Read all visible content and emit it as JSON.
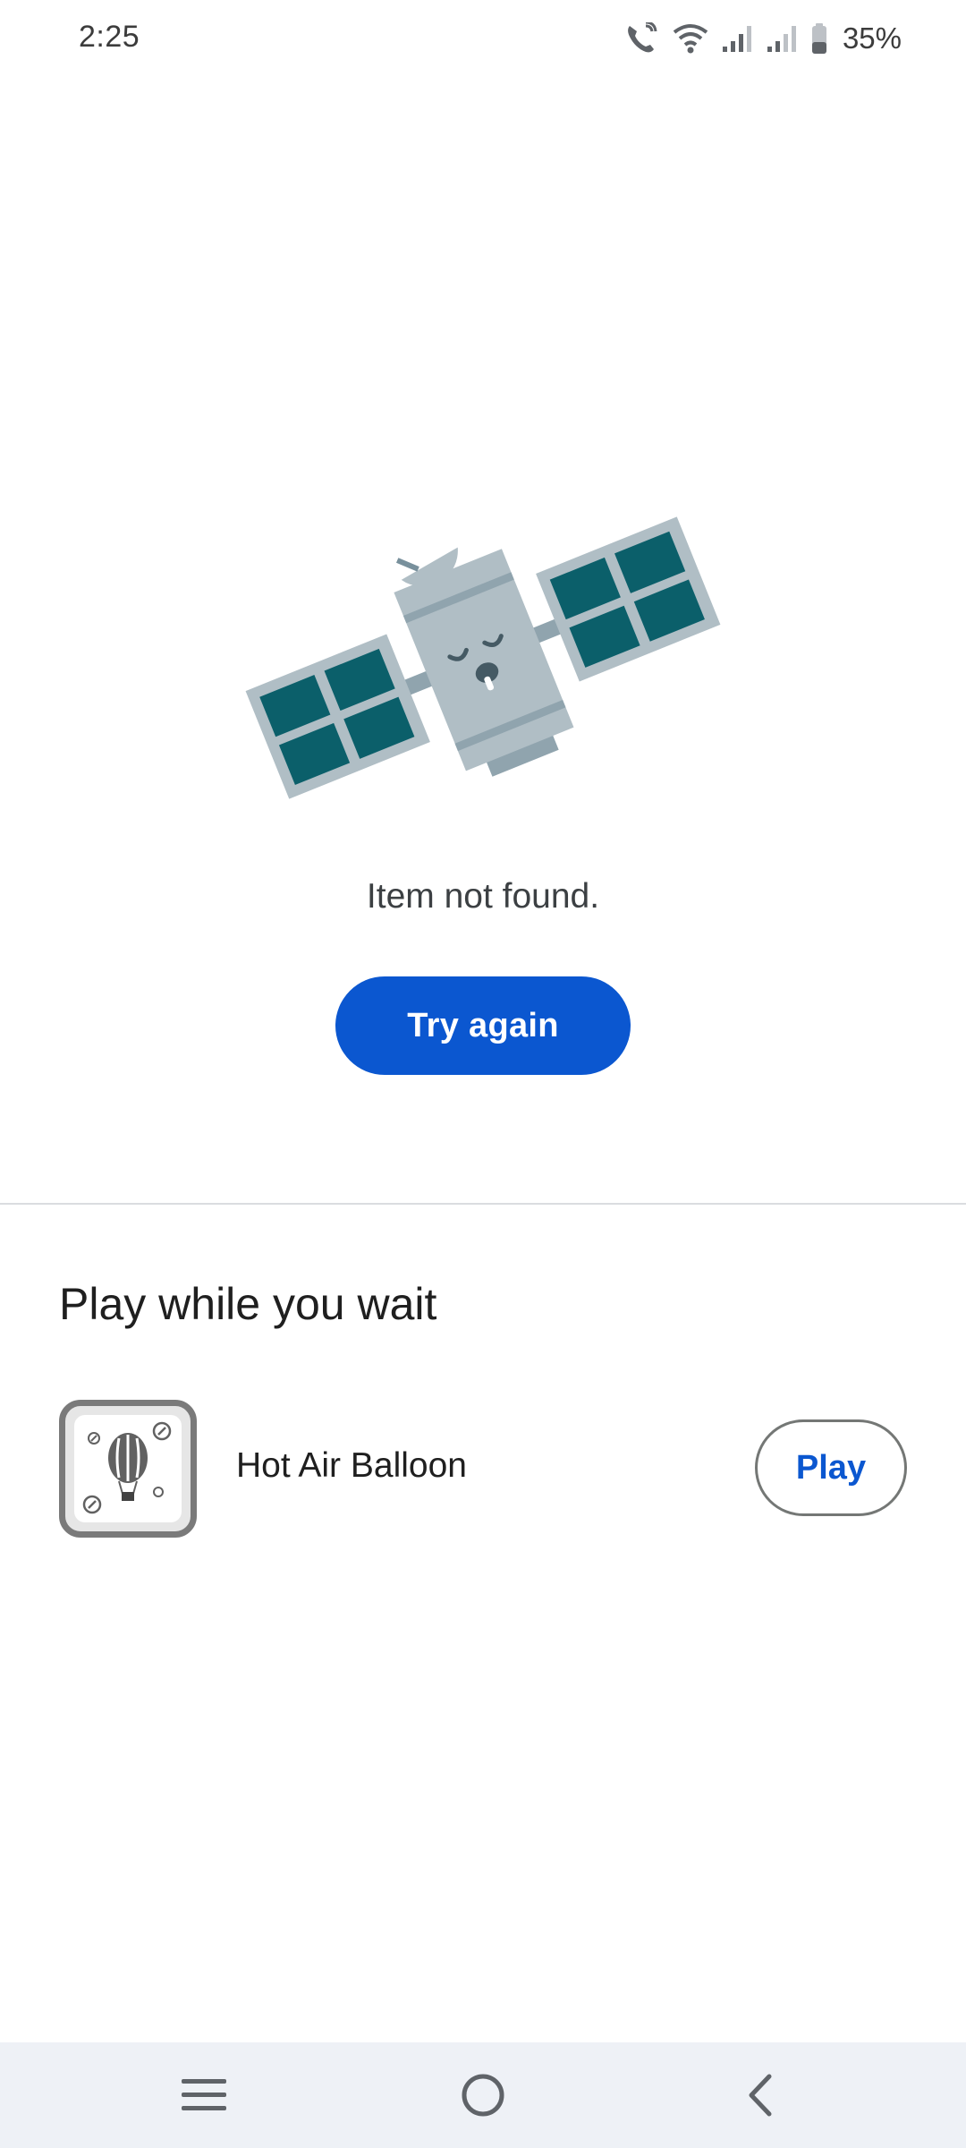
{
  "status_bar": {
    "time": "2:25",
    "battery_percent": "35%",
    "icons": [
      "wifi-calling-icon",
      "wifi-icon",
      "signal-icon",
      "signal-icon",
      "battery-icon"
    ]
  },
  "error": {
    "illustration": "sleeping-satellite",
    "message": "Item not found.",
    "retry_label": "Try again"
  },
  "play_section": {
    "title": "Play while you wait",
    "games": [
      {
        "name": "Hot Air Balloon",
        "icon": "hot-air-balloon-icon",
        "action_label": "Play"
      }
    ]
  },
  "nav_bar": {
    "icons": [
      "recents-icon",
      "home-icon",
      "back-icon"
    ]
  },
  "colors": {
    "primary": "#0b57d0",
    "satellite_panel": "#0b5f6a",
    "satellite_body": "#b0bec5",
    "nav_background": "#eef1f6"
  }
}
